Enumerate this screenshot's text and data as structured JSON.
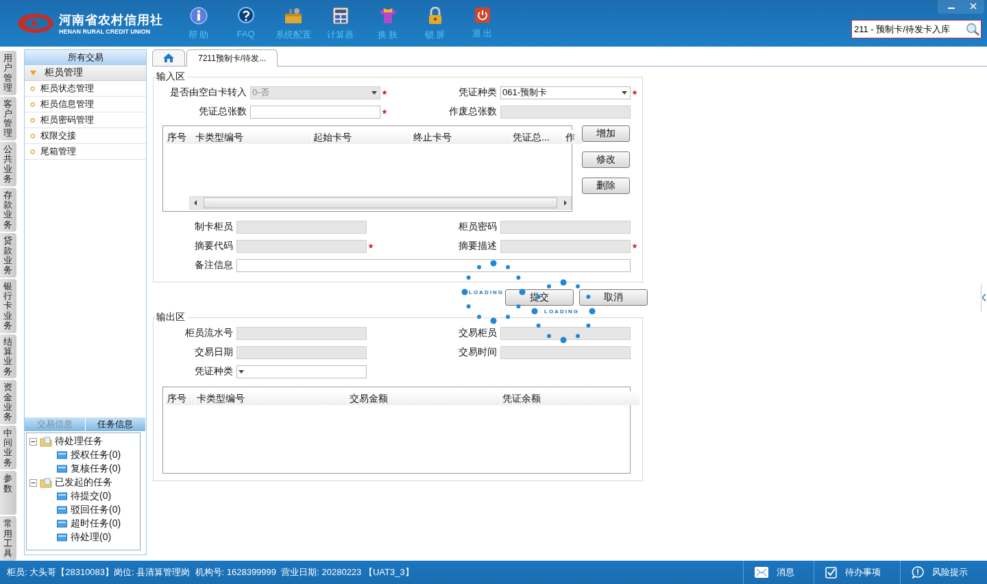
{
  "header": {
    "logo_cn": "河南省农村信用社",
    "logo_en": "HENAN RURAL CREDIT UNION",
    "nav": [
      {
        "kind": "help",
        "label": "帮 助"
      },
      {
        "kind": "faq",
        "label": "FAQ"
      },
      {
        "kind": "settings",
        "label": "系统配置"
      },
      {
        "kind": "calculator",
        "label": "计算器"
      },
      {
        "kind": "skin",
        "label": "换 肤"
      },
      {
        "kind": "lock",
        "label": "锁 屏"
      },
      {
        "kind": "exit",
        "label": "退 出"
      }
    ],
    "search": {
      "value": "211 - 预制卡/待发卡入库"
    }
  },
  "side_tabs": [
    {
      "label": "用户管理",
      "selected": false
    },
    {
      "label": "客户管理",
      "selected": false
    },
    {
      "label": "公共业务",
      "selected": false
    },
    {
      "label": "存款业务",
      "selected": false
    },
    {
      "label": "贷款业务",
      "selected": false
    },
    {
      "label": "银行卡业务",
      "selected": false
    },
    {
      "label": "结算业务",
      "selected": false
    },
    {
      "label": "资金业务",
      "selected": false
    },
    {
      "label": "中间业务",
      "selected": false
    },
    {
      "label": "参数",
      "selected": false
    },
    {
      "label": "常用工具",
      "selected": false
    }
  ],
  "sidebar": {
    "title": "所有交易",
    "group": {
      "label": "柜员管理",
      "expanded": true,
      "items": [
        "柜员状态管理",
        "柜员信息管理",
        "柜员密码管理",
        "权限交接",
        "尾箱管理"
      ]
    },
    "bottom_tabs": [
      {
        "label": "交易信息",
        "selected": false
      },
      {
        "label": "任务信息",
        "selected": true
      }
    ],
    "tree": [
      {
        "label": "待处理任务",
        "expanded": true,
        "children": [
          {
            "label": "授权任务(0)"
          },
          {
            "label": "复核任务(0)"
          }
        ]
      },
      {
        "label": "已发起的任务",
        "expanded": true,
        "children": [
          {
            "label": "待提交(0)"
          },
          {
            "label": "驳回任务(0)"
          },
          {
            "label": "超时任务(0)"
          },
          {
            "label": "待处理(0)"
          }
        ]
      }
    ]
  },
  "tabs": [
    {
      "kind": "home",
      "selected": false
    },
    {
      "kind": "page",
      "label": "7211预制卡/待发...",
      "selected": true
    }
  ],
  "input_area": {
    "legend": "输入区",
    "top_rows": [
      [
        {
          "label": "是否由空白卡转入",
          "kind": "select",
          "value": "0-否",
          "disabled": true,
          "required": true
        },
        {
          "label": "凭证种类",
          "kind": "select",
          "value": "061-预制卡",
          "disabled": false,
          "required": true
        }
      ],
      [
        {
          "label": "凭证总张数",
          "kind": "text",
          "disabled": false,
          "required": true
        },
        {
          "label": "作废总张数",
          "kind": "text",
          "disabled": true,
          "required": false
        }
      ]
    ],
    "table": {
      "columns": [
        "序号",
        "卡类型编号",
        "起始卡号",
        "终止卡号",
        "凭证总...",
        "作"
      ]
    },
    "table_buttons": [
      "增加",
      "修改",
      "删除"
    ],
    "bottom_rows": [
      [
        {
          "label": "制卡柜员",
          "disabled": true,
          "required": false
        },
        {
          "label": "柜员密码",
          "disabled": true,
          "required": false
        }
      ],
      [
        {
          "label": "摘要代码",
          "disabled": true,
          "required": true
        },
        {
          "label": "摘要描述",
          "disabled": true,
          "required": true
        }
      ],
      [
        {
          "label": "备注信息",
          "disabled": false,
          "required": false
        }
      ]
    ]
  },
  "actions": [
    "提交",
    "取消"
  ],
  "output_area": {
    "legend": "输出区",
    "rows": [
      [
        {
          "label": "柜员流水号",
          "kind": "text",
          "disabled": true,
          "required": false
        },
        {
          "label": "交易柜员",
          "kind": "text",
          "disabled": true,
          "required": false
        }
      ],
      [
        {
          "label": "交易日期",
          "kind": "text",
          "disabled": true,
          "required": false
        },
        {
          "label": "交易时间",
          "kind": "text",
          "disabled": true,
          "required": false
        }
      ],
      [
        {
          "label": "凭证种类",
          "kind": "select",
          "disabled": false,
          "required": false
        }
      ]
    ],
    "table": {
      "columns": [
        "序号",
        "卡类型编号",
        "交易金额",
        "凭证余额"
      ]
    }
  },
  "loading": [
    {
      "label": "LOADING"
    },
    {
      "label": "LOADING"
    }
  ],
  "status_bar": {
    "text": "柜员: 大头哥【28310083】岗位: 县清算管理岗  机构号: 1628399999  营业日期: 20280223 【UAT3_3】",
    "items": [
      {
        "kind": "message",
        "label": "消息"
      },
      {
        "kind": "todo",
        "label": "待办事项"
      },
      {
        "kind": "risk",
        "label": "风险提示"
      }
    ]
  }
}
